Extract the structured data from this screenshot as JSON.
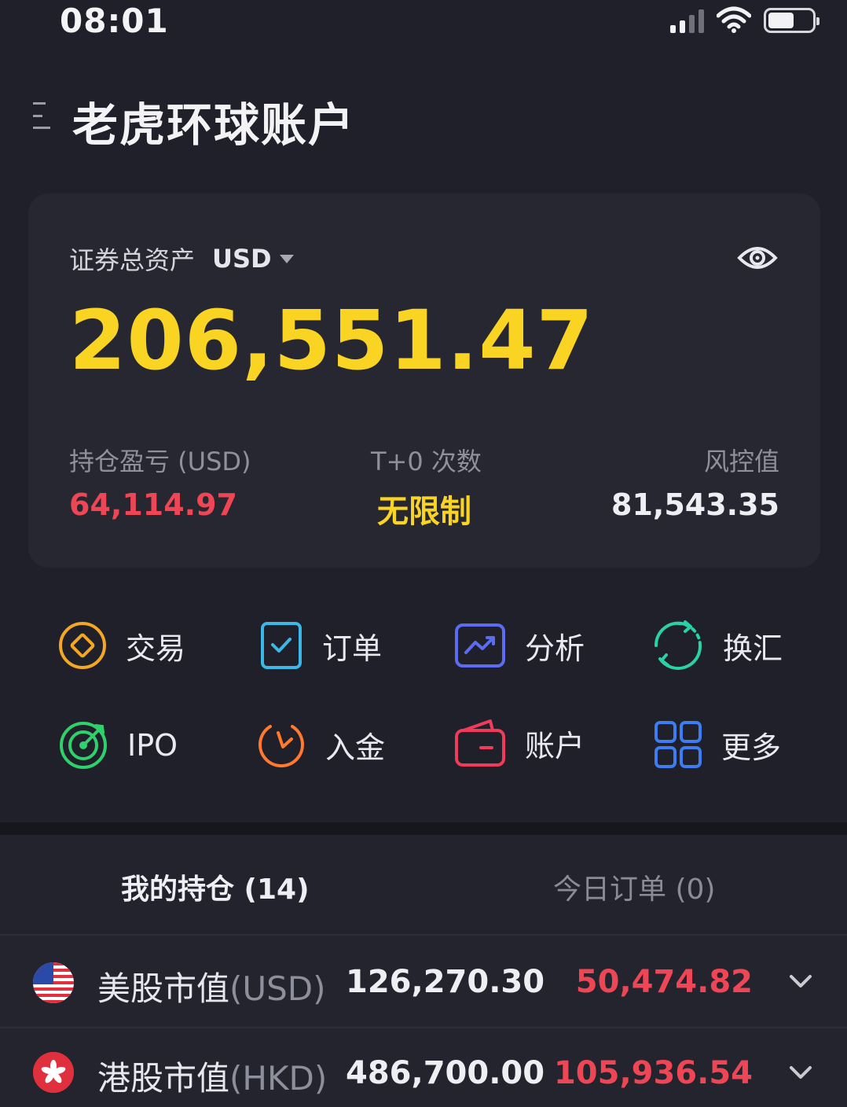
{
  "status_bar": {
    "time": "08:01"
  },
  "header": {
    "title": "老虎环球账户"
  },
  "asset_card": {
    "label": "证券总资产",
    "currency": "USD",
    "total": "206,551.47",
    "metrics": [
      {
        "label": "持仓盈亏 (USD)",
        "value": "64,114.97"
      },
      {
        "label": "T+0 次数",
        "value": "无限制"
      },
      {
        "label": "风控值",
        "value": "81,543.35"
      }
    ]
  },
  "actions": [
    {
      "label": "交易",
      "icon": "trade-icon"
    },
    {
      "label": "订单",
      "icon": "order-icon"
    },
    {
      "label": "分析",
      "icon": "analysis-icon"
    },
    {
      "label": "换汇",
      "icon": "exchange-icon"
    },
    {
      "label": "IPO",
      "icon": "ipo-icon"
    },
    {
      "label": "入金",
      "icon": "deposit-icon"
    },
    {
      "label": "账户",
      "icon": "wallet-icon"
    },
    {
      "label": "更多",
      "icon": "grid-icon"
    }
  ],
  "tabs": {
    "holdings": "我的持仓 (14)",
    "orders": "今日订单 (0)"
  },
  "positions": [
    {
      "market": "美股市值",
      "currency": "(USD)",
      "value": "126,270.30",
      "pl": "50,474.82"
    },
    {
      "market": "港股市值",
      "currency": "(HKD)",
      "value": "486,700.00",
      "pl": "105,936.54"
    }
  ],
  "colors": {
    "accent_yellow": "#f9d423",
    "loss_red": "#ef4655",
    "background": "#1f2029",
    "card": "#262731"
  }
}
